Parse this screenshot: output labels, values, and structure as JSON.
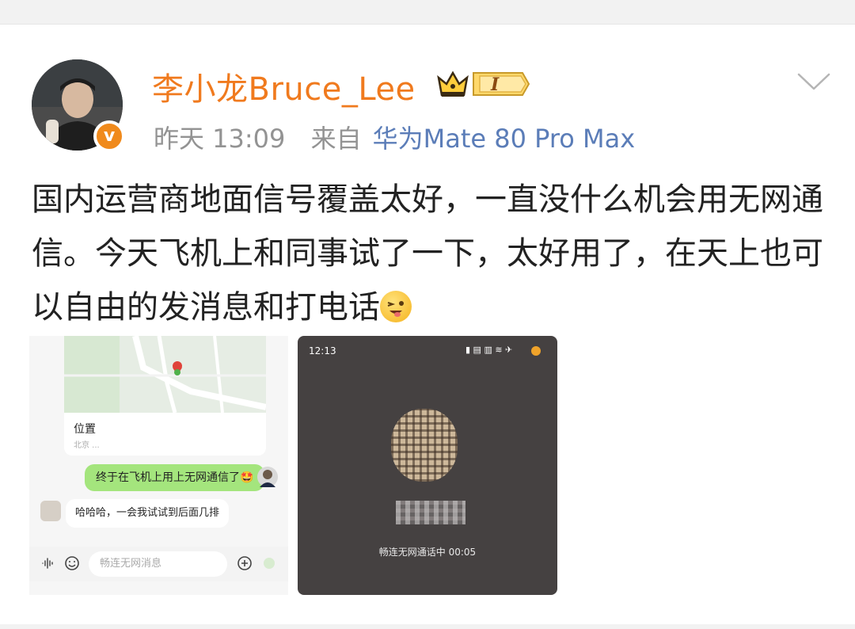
{
  "post": {
    "username": "李小龙Bruce_Lee",
    "badge_level": "I",
    "time": "昨天 13:09",
    "source_prefix": "来自",
    "device": "华为Mate 80 Pro Max",
    "text": "国内运营商地面信号覆盖太好，一直没什么机会用无网通信。今天飞机上和同事试了一下，太好用了，在天上也可以自由的发消息和打电话"
  },
  "image1": {
    "location_title": "位置",
    "location_sub": "北京 ... ",
    "bubble_sent": "终于在飞机上用上无网通信了🤩",
    "bubble_received": "哈哈哈，一会我试试到后面几排",
    "input_placeholder": "畅连无网消息"
  },
  "image2": {
    "status_time": "12:13",
    "status_icons": "▮ ▤ ▥ ≋ ✈",
    "call_status": "畅连无网通话中 00:05"
  },
  "colors": {
    "username": "#f07a1e",
    "device": "#5b7db8",
    "meta": "#939393",
    "verified": "#f08a1c",
    "chat_bubble": "#a4e57d"
  },
  "icons": [
    "verified-badge-icon",
    "crown-badge-icon",
    "chevron-down-icon",
    "winking-emoji-icon",
    "voice-icon",
    "emoji-icon",
    "add-icon"
  ]
}
